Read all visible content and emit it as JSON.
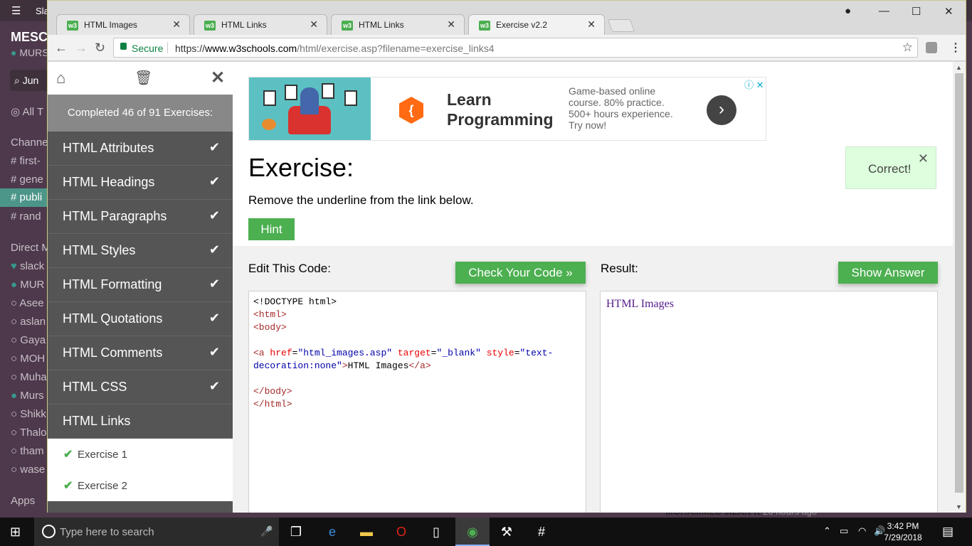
{
  "slack": {
    "app_title": "Sla",
    "team": "MESC",
    "user": "MURS",
    "jump": "Jun",
    "all_threads": "All T",
    "channels_heading": "Channe",
    "channels": [
      "# first-",
      "# gene",
      "# publi",
      "# rand"
    ],
    "direct_heading": "Direct M",
    "dms": [
      "slack",
      "MUR",
      "Asee",
      "aslan",
      "Gaya",
      "MOH",
      "Muha",
      "Murs",
      "Shikk",
      "Thalo",
      "tham",
      "wase"
    ],
    "apps": "Apps",
    "feed_snippet": "MOHAMMED JIZAN K",
    "feed_time": "20 hours ago"
  },
  "browser": {
    "tabs": [
      {
        "title": "HTML Images",
        "favicon": "w3"
      },
      {
        "title": "HTML Links",
        "favicon": "w3"
      },
      {
        "title": "HTML Links",
        "favicon": "w3"
      },
      {
        "title": "Exercise v2.2",
        "favicon": "w3"
      }
    ],
    "secure_label": "Secure",
    "url_scheme": "https://",
    "url_host": "www.w3schools.com",
    "url_path": "/html/exercise.asp?filename=exercise_links4"
  },
  "sidebar": {
    "progress": "Completed 46 of 91 Exercises:",
    "items": [
      {
        "label": "HTML Attributes",
        "done": true
      },
      {
        "label": "HTML Headings",
        "done": true
      },
      {
        "label": "HTML Paragraphs",
        "done": true
      },
      {
        "label": "HTML Styles",
        "done": true
      },
      {
        "label": "HTML Formatting",
        "done": true
      },
      {
        "label": "HTML Quotations",
        "done": true
      },
      {
        "label": "HTML Comments",
        "done": true
      },
      {
        "label": "HTML CSS",
        "done": true
      },
      {
        "label": "HTML Links",
        "done": false
      }
    ],
    "sub_items": [
      "Exercise 1",
      "Exercise 2"
    ]
  },
  "ad": {
    "title": "Learn Programming",
    "desc_lines": [
      "Game-based online",
      "course. 80% practice.",
      "500+ hours experience.",
      "Try now!"
    ]
  },
  "exercise": {
    "title": "Exercise:",
    "correct_label": "Correct!",
    "instruction": "Remove the underline from the link below.",
    "hint_label": "Hint",
    "edit_label": "Edit This Code:",
    "check_label": "Check Your Code »",
    "result_label": "Result:",
    "answer_label": "Show Answer",
    "code": {
      "doctype": "<!DOCTYPE html>",
      "html_open": "<html>",
      "body_open": "<body>",
      "a_open": "<a",
      "href_attr": " href",
      "href_val": "\"html_images.asp\"",
      "target_attr": " target",
      "target_val": "\"_blank\"",
      "style_attr": " style",
      "style_val_1": "\"text-",
      "style_val_2": "decoration:none\"",
      "a_gt": ">",
      "link_text": "HTML Images",
      "a_close": "</a>",
      "eq": "=",
      "body_close": "</body>",
      "html_close": "</html>"
    },
    "result_link": "HTML Images"
  },
  "taskbar": {
    "search_placeholder": "Type here to search",
    "time": "3:42 PM",
    "date": "7/29/2018"
  }
}
